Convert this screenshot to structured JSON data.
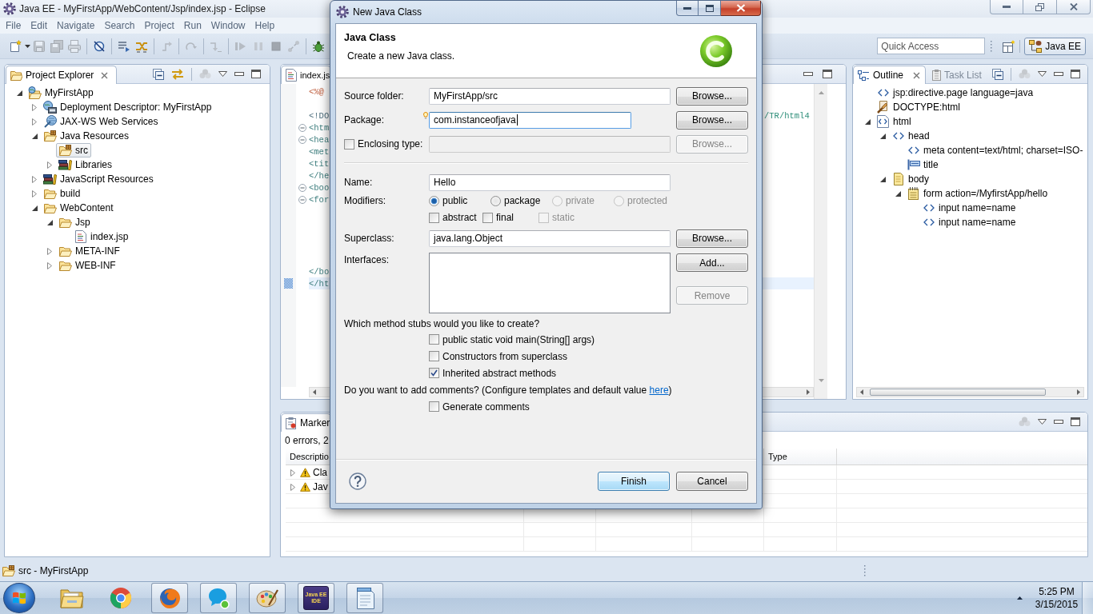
{
  "window": {
    "title": "Java EE - MyFirstApp/WebContent/Jsp/index.jsp - Eclipse"
  },
  "menu": [
    "File",
    "Edit",
    "Navigate",
    "Search",
    "Project",
    "Run",
    "Window",
    "Help"
  ],
  "toolbar": {
    "groups": [
      [
        {
          "kind": "new",
          "disabled": false
        },
        {
          "kind": "save",
          "disabled": true
        },
        {
          "kind": "save-all",
          "disabled": true
        },
        {
          "kind": "print",
          "disabled": true
        }
      ],
      [
        {
          "kind": "skip-breakpoints",
          "disabled": false
        }
      ],
      [
        {
          "kind": "task-list",
          "disabled": false
        },
        {
          "kind": "open-type",
          "disabled": false
        }
      ],
      [
        {
          "kind": "step-return",
          "disabled": true
        }
      ],
      [
        {
          "kind": "redo",
          "disabled": true
        }
      ],
      [
        {
          "kind": "step-into",
          "disabled": true
        }
      ],
      [
        {
          "kind": "resume",
          "disabled": true
        },
        {
          "kind": "suspend",
          "disabled": true
        },
        {
          "kind": "terminate",
          "disabled": true
        },
        {
          "kind": "disconnect",
          "disabled": true
        }
      ],
      [
        {
          "kind": "debug",
          "disabled": false
        }
      ]
    ],
    "quick_access": {
      "placeholder": "Quick Access"
    },
    "perspective": {
      "label": "Java EE",
      "selected": true
    }
  },
  "project_explorer": {
    "tabs": [
      {
        "label": "Project Explorer",
        "selected": true
      }
    ],
    "tree": [
      {
        "label": "MyFirstApp",
        "kind": "project",
        "expanded": true,
        "selected": false,
        "children": [
          {
            "label": "Deployment Descriptor: MyFirstApp",
            "kind": "descriptor",
            "expanded": false,
            "selected": false
          },
          {
            "label": "JAX-WS Web Services",
            "kind": "web-services",
            "expanded": false,
            "selected": false
          },
          {
            "label": "Java Resources",
            "kind": "java-resources",
            "expanded": true,
            "selected": false,
            "children": [
              {
                "label": "src",
                "kind": "source-folder",
                "selected": true
              },
              {
                "label": "Libraries",
                "kind": "library",
                "expanded": false,
                "selected": false
              }
            ]
          },
          {
            "label": "JavaScript Resources",
            "kind": "library",
            "expanded": false,
            "selected": false
          },
          {
            "label": "build",
            "kind": "folder",
            "expanded": false,
            "selected": false
          },
          {
            "label": "WebContent",
            "kind": "folder",
            "expanded": true,
            "selected": false,
            "children": [
              {
                "label": "Jsp",
                "kind": "folder",
                "expanded": true,
                "selected": false,
                "children": [
                  {
                    "label": "index.jsp",
                    "kind": "file",
                    "selected": false
                  }
                ]
              },
              {
                "label": "META-INF",
                "kind": "folder",
                "expanded": false,
                "selected": false
              },
              {
                "label": "WEB-INF",
                "kind": "folder",
                "expanded": false,
                "selected": false
              }
            ]
          }
        ]
      }
    ]
  },
  "editor": {
    "tabs": [
      {
        "label": "index.js",
        "selected": true
      }
    ],
    "lines": [
      {
        "kind": "directive",
        "text": "<%@",
        "fold": false,
        "current": false
      },
      {
        "kind": "blank",
        "fold": false,
        "current": false
      },
      {
        "kind": "doctype",
        "text": "<!DO",
        "tail": "/TR/html4",
        "fold": false,
        "current": false
      },
      {
        "kind": "tag",
        "text": "<htm",
        "fold": true,
        "current": false
      },
      {
        "kind": "tag",
        "text": "<hea",
        "fold": true,
        "current": false
      },
      {
        "kind": "tag",
        "text": "<met",
        "fold": false,
        "current": false
      },
      {
        "kind": "tag",
        "text": "<tit",
        "fold": false,
        "current": false
      },
      {
        "kind": "tag",
        "text": "</he",
        "fold": false,
        "current": false
      },
      {
        "kind": "tag",
        "text": "<boo",
        "fold": true,
        "current": false
      },
      {
        "kind": "tag",
        "text": "<for",
        "fold": true,
        "current": false
      },
      {
        "kind": "blank",
        "fold": false,
        "current": false
      },
      {
        "kind": "blank",
        "fold": false,
        "current": false
      },
      {
        "kind": "blank",
        "fold": false,
        "current": false
      },
      {
        "kind": "blank",
        "fold": false,
        "current": false
      },
      {
        "kind": "blank",
        "fold": false,
        "current": false
      },
      {
        "kind": "tag",
        "text": "</bo",
        "fold": false,
        "current": false
      },
      {
        "kind": "tag",
        "text": "</ht",
        "fold": false,
        "current": true
      }
    ]
  },
  "outline": {
    "tabs": [
      {
        "label": "Outline",
        "selected": true
      },
      {
        "label": "Task List",
        "selected": false
      }
    ],
    "tree": [
      {
        "label": "jsp:directive.page language=java",
        "kind": "tag",
        "selected": false
      },
      {
        "label": "DOCTYPE:html",
        "kind": "doctype",
        "selected": false
      },
      {
        "label": "html",
        "kind": "html",
        "expanded": true,
        "selected": false,
        "children": [
          {
            "label": "head",
            "kind": "tag",
            "expanded": true,
            "selected": false,
            "children": [
              {
                "label": "meta content=text/html; charset=ISO-",
                "kind": "tag",
                "selected": false
              },
              {
                "label": "title",
                "kind": "title",
                "selected": false
              }
            ]
          },
          {
            "label": "body",
            "kind": "body",
            "expanded": true,
            "selected": false,
            "children": [
              {
                "label": "form action=/MyfirstApp/hello",
                "kind": "form",
                "expanded": true,
                "selected": false,
                "children": [
                  {
                    "label": "input name=name",
                    "kind": "tag",
                    "selected": false
                  },
                  {
                    "label": "input name=name",
                    "kind": "tag",
                    "selected": false
                  }
                ]
              }
            ]
          }
        ]
      }
    ]
  },
  "markers": {
    "tabs": [
      {
        "label": "Marker",
        "selected": true
      }
    ],
    "summary": "0 errors, 2",
    "columns": [
      "Descriptio",
      "Type"
    ],
    "rows": [
      {
        "description": "Cla",
        "expanded": false
      },
      {
        "description": "Jav",
        "expanded": false
      }
    ]
  },
  "status_bar": {
    "text": "src - MyFirstApp"
  },
  "taskbar": {
    "apps": [
      {
        "kind": "file-manager",
        "running": false
      },
      {
        "kind": "browser",
        "running": false
      },
      {
        "kind": "fox-browser",
        "running": true
      },
      {
        "kind": "messenger",
        "running": true
      },
      {
        "kind": "paint",
        "running": true
      },
      {
        "kind": "ide",
        "running": true,
        "icon_text": "Java EE IDE"
      },
      {
        "kind": "notepad",
        "running": true
      }
    ],
    "clock": {
      "time": "5:25 PM",
      "date": "3/15/2015"
    }
  },
  "dialog": {
    "title": "New Java Class",
    "heading": "Java Class",
    "description": "Create a new Java class.",
    "source_folder": {
      "label": "Source folder:",
      "value": "MyFirstApp/src",
      "focused": false,
      "disabled": false,
      "button": {
        "label": "Browse...",
        "disabled": false
      }
    },
    "package": {
      "label": "Package:",
      "value": "com.instanceofjava",
      "focused": true,
      "disabled": false,
      "button": {
        "label": "Browse...",
        "disabled": false
      }
    },
    "enclosing_type": {
      "label": "Enclosing type:",
      "checked": false,
      "focused": false,
      "disabled": true,
      "button": {
        "label": "Browse...",
        "disabled": true
      }
    },
    "name": {
      "label": "Name:",
      "value": "Hello",
      "focused": false,
      "disabled": false
    },
    "modifiers": {
      "label": "Modifiers:",
      "access": [
        {
          "label": "public",
          "selected": true,
          "disabled": false
        },
        {
          "label": "package",
          "selected": false,
          "disabled": false
        },
        {
          "label": "private",
          "selected": false,
          "disabled": true
        },
        {
          "label": "protected",
          "selected": false,
          "disabled": true
        }
      ],
      "flags": [
        {
          "label": "abstract",
          "checked": false,
          "disabled": false
        },
        {
          "label": "final",
          "checked": false,
          "disabled": false
        },
        {
          "label": "static",
          "checked": false,
          "disabled": true
        }
      ]
    },
    "superclass": {
      "label": "Superclass:",
      "value": "java.lang.Object",
      "focused": false,
      "disabled": false,
      "button": {
        "label": "Browse...",
        "disabled": false
      }
    },
    "interfaces": {
      "label": "Interfaces:",
      "buttons": [
        {
          "label": "Add...",
          "disabled": false
        },
        {
          "label": "Remove",
          "disabled": true
        }
      ]
    },
    "stubs": {
      "question": "Which method stubs would you like to create?",
      "options": [
        {
          "label": "public static void main(String[] args)",
          "checked": false
        },
        {
          "label": "Constructors from superclass",
          "checked": false
        },
        {
          "label": "Inherited abstract methods",
          "checked": true
        }
      ]
    },
    "comments": {
      "question": "Do you want to add comments? (Configure templates and default value",
      "link": "here",
      "closing": ")",
      "options": [
        {
          "label": "Generate comments",
          "checked": false
        }
      ]
    },
    "buttons": [
      {
        "label": "Finish",
        "default": true
      },
      {
        "label": "Cancel",
        "default": false
      }
    ]
  }
}
